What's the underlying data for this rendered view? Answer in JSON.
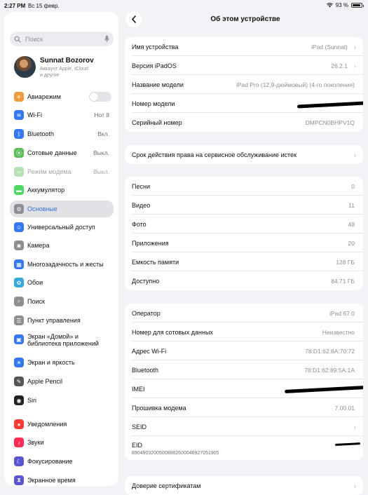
{
  "status": {
    "time": "2:27 PM",
    "date": "Вс 15 февр.",
    "battery": "93 %",
    "battery_level": 0.93
  },
  "sidebar": {
    "search_placeholder": "Поиск",
    "profile": {
      "name": "Sunnat Bozorov",
      "subtitle_line1": "Аккаунт Apple, iCloud",
      "subtitle_line2": "и другое"
    },
    "items": [
      {
        "label": "Авиарежим",
        "value": "",
        "icon": "airplane-icon",
        "color": "#f19a37"
      },
      {
        "label": "Wi-Fi",
        "value": "Нот 8",
        "icon": "wifi-icon",
        "color": "#3478f6"
      },
      {
        "label": "Bluetooth",
        "value": "Вкл.",
        "icon": "bluetooth-icon",
        "color": "#3478f6"
      },
      {
        "label": "Сотовые данные",
        "value": "Выкл.",
        "icon": "antenna-icon",
        "color": "#5ac05a"
      },
      {
        "label": "Режим модема",
        "value": "Выкл.",
        "icon": "link-icon",
        "color": "#5ac05a"
      },
      {
        "label": "Аккумулятор",
        "value": "",
        "icon": "battery-icon",
        "color": "#4cd964"
      },
      {
        "label": "Основные",
        "value": "",
        "icon": "gear-icon",
        "color": "#8e8e93"
      },
      {
        "label": "Универсальный доступ",
        "value": "",
        "icon": "accessibility-icon",
        "color": "#3478f6"
      },
      {
        "label": "Камера",
        "value": "",
        "icon": "camera-icon",
        "color": "#8e8e93"
      },
      {
        "label": "Многозадачность и жесты",
        "value": "",
        "icon": "multitask-icon",
        "color": "#3478f6"
      },
      {
        "label": "Обои",
        "value": "",
        "icon": "wallpaper-icon",
        "color": "#34aadc"
      },
      {
        "label": "Поиск",
        "value": "",
        "icon": "search-icon",
        "color": "#8e8e93"
      },
      {
        "label": "Пункт управления",
        "value": "",
        "icon": "control-center-icon",
        "color": "#8e8e93"
      },
      {
        "label": "Экран «Домой» и библиотека приложений",
        "value": "",
        "icon": "home-screen-icon",
        "color": "#3478f6"
      },
      {
        "label": "Экран и яркость",
        "value": "",
        "icon": "brightness-icon",
        "color": "#3478f6"
      },
      {
        "label": "Apple Pencil",
        "value": "",
        "icon": "pencil-icon",
        "color": "#555"
      },
      {
        "label": "Siri",
        "value": "",
        "icon": "siri-icon",
        "color": "#222"
      },
      {
        "label": "Уведомления",
        "value": "",
        "icon": "bell-icon",
        "color": "#ff3b30"
      },
      {
        "label": "Звуки",
        "value": "",
        "icon": "speaker-icon",
        "color": "#ff2d55"
      },
      {
        "label": "Фокусирование",
        "value": "",
        "icon": "moon-icon",
        "color": "#5856d6"
      },
      {
        "label": "Экранное время",
        "value": "",
        "icon": "hourglass-icon",
        "color": "#5856d6"
      }
    ]
  },
  "main": {
    "title": "Об этом устройстве",
    "group1": [
      {
        "label": "Имя устройства",
        "value": "iPad (Sunnat)",
        "chevron": true
      },
      {
        "label": "Версия iPadOS",
        "value": "26.2.1",
        "chevron": true
      },
      {
        "label": "Название модели",
        "value": "iPad Pro (12,9-дюймовый) (4-го поколения)",
        "chevron": false
      },
      {
        "label": "Номер модели",
        "value": "",
        "chevron": false
      },
      {
        "label": "Серийный номер",
        "value": "DMPCN0BHPV1Q",
        "chevron": false
      }
    ],
    "group2": [
      {
        "label": "Срок действия права на сервисное обслуживание истек",
        "value": "",
        "chevron": true
      }
    ],
    "group3": [
      {
        "label": "Песни",
        "value": "0"
      },
      {
        "label": "Видео",
        "value": "11"
      },
      {
        "label": "Фото",
        "value": "48"
      },
      {
        "label": "Приложения",
        "value": "20"
      },
      {
        "label": "Емкость памяти",
        "value": "128 ГБ"
      },
      {
        "label": "Доступно",
        "value": "84,71 ГБ"
      }
    ],
    "group4": [
      {
        "label": "Оператор",
        "value": "iPad 67.0",
        "chevron": false
      },
      {
        "label": "Номер для сотовых данных",
        "value": "Неизвестно",
        "chevron": false
      },
      {
        "label": "Адрес Wi-Fi",
        "value": "78:D1:62:8A:70:72",
        "chevron": false
      },
      {
        "label": "Bluetooth",
        "value": "78:D1:62:89:5A:1A",
        "chevron": false
      },
      {
        "label": "IMEI",
        "value": "",
        "chevron": false
      },
      {
        "label": "Прошивка модема",
        "value": "7.00.01",
        "chevron": false
      },
      {
        "label": "SEID",
        "value": "",
        "chevron": true
      },
      {
        "label": "EID",
        "value": "89049032005008882600046927051905",
        "chevron": false
      }
    ],
    "group5": [
      {
        "label": "Доверие сертификатам",
        "value": "",
        "chevron": true
      }
    ]
  }
}
